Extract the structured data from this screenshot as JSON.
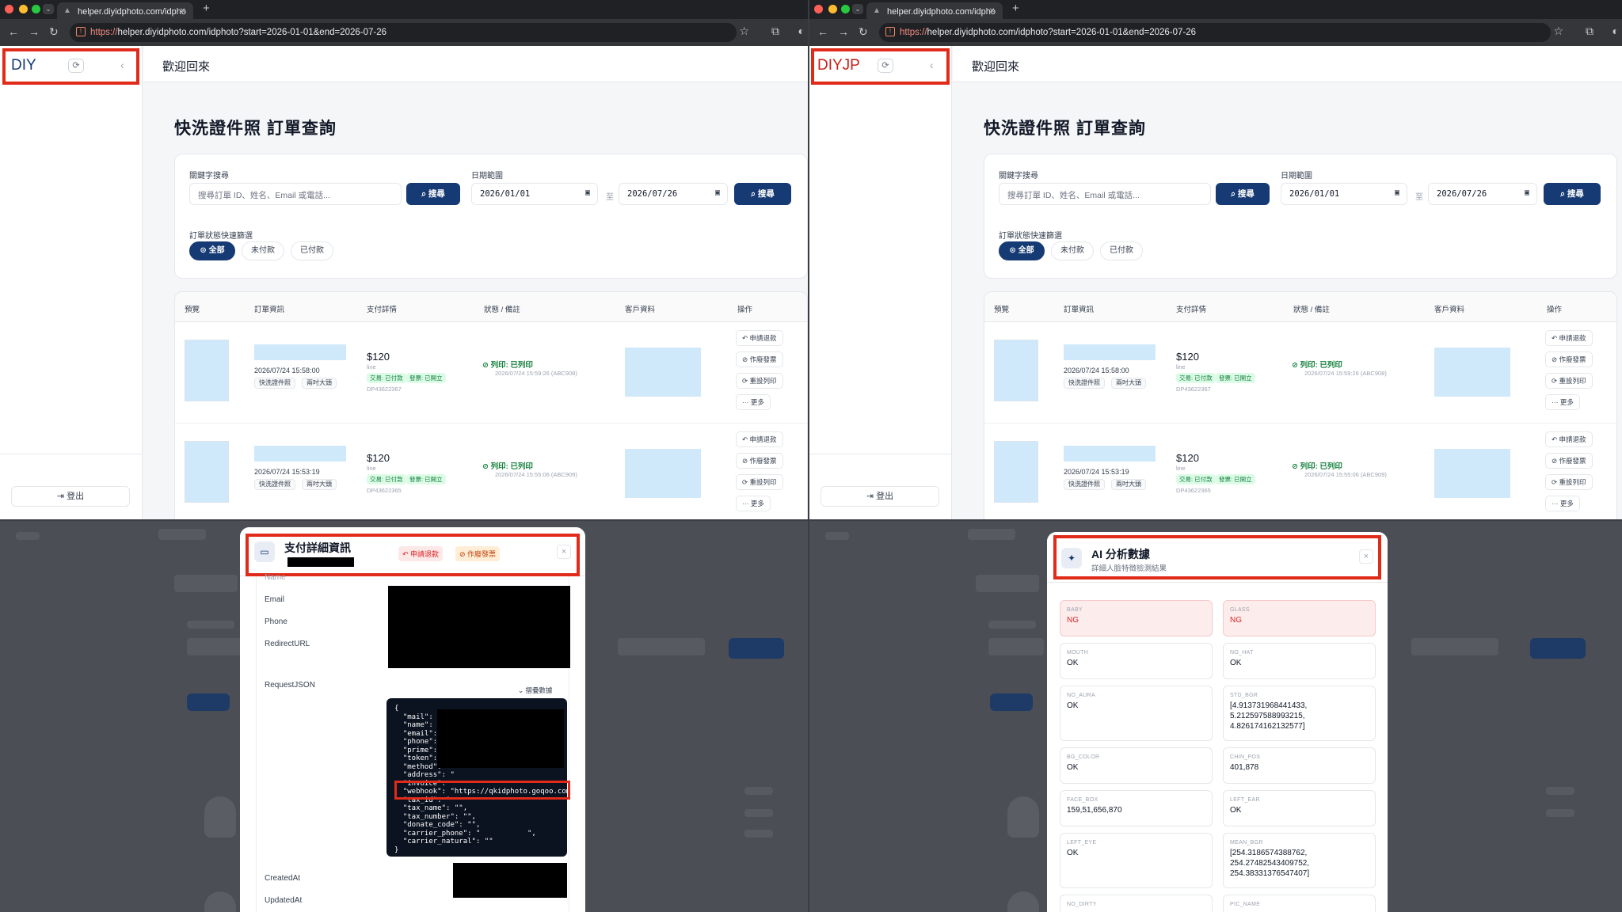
{
  "browser": {
    "tab_title": "helper.diyidphoto.com/idpho",
    "url_scheme": "https://",
    "url_rest": "helper.diyidphoto.com/idphoto?start=2026-01-01&end=2026-07-26"
  },
  "left_app": {
    "brand": "DIY",
    "logout": "登出",
    "welcome": "歡迎回來",
    "title": "快洗證件照 訂單查詢"
  },
  "right_app": {
    "brand": "DIYJP",
    "logout": "登出",
    "welcome": "歡迎回來",
    "title": "快洗證件照 訂單查詢"
  },
  "filters": {
    "keyword_label": "關鍵字搜尋",
    "keyword_placeholder": "搜尋訂單 ID、姓名、Email 或電話...",
    "search_label": "搜尋",
    "date_label": "日期範圍",
    "start_date": "2026/01/01",
    "end_date": "2026/07/26",
    "to_label": "至",
    "status_label": "訂單狀態快速篩選",
    "status_options": [
      "全部",
      "未付款",
      "已付款"
    ]
  },
  "table": {
    "headers": [
      "預覽",
      "訂單資訊",
      "支付詳情",
      "狀態 / 備註",
      "客戶資料",
      "操作"
    ],
    "rows": [
      {
        "date": "2026/07/24 15:58:00",
        "tag1": "快洗證件照",
        "tag2": "兩吋大頭",
        "price": "$120",
        "method": "line",
        "pay_status": "交易: 已付款",
        "invoice": "發票: 已開立",
        "order_no": "DP43622367",
        "status": "列印: 已列印",
        "status_note": "2026/07/24 15:59:26 (ABC908)"
      },
      {
        "date": "2026/07/24 15:53:19",
        "tag1": "快洗證件照",
        "tag2": "兩吋大頭",
        "price": "$120",
        "method": "line",
        "pay_status": "交易: 已付款",
        "invoice": "發票: 已開立",
        "order_no": "DP43622365",
        "status": "列印: 已列印",
        "status_note": "2026/07/24 15:55:06 (ABC909)"
      }
    ],
    "actions": [
      "申請退款",
      "作廢發票",
      "重設列印",
      "更多"
    ]
  },
  "payment_modal": {
    "title": "支付詳細資訊",
    "refund_label": "申請退款",
    "void_label": "作廢發票",
    "fields": [
      "Name",
      "Email",
      "Phone",
      "RedirectURL",
      "RequestJSON",
      "CreatedAt",
      "UpdatedAt"
    ],
    "collapse_label": "摺疊數據",
    "json_lines": [
      "{",
      "  \"mail\": \"\",",
      "  \"name\": \"\",",
      "  \"email\": \"",
      "  \"phone\": \"",
      "  \"prime\": \"",
      "  \"token\": \"",
      "  \"method\": \"",
      "  \"address\": \"",
      "  \"invoice\": ",
      "  \"webhook\": \"https://qkidphoto.goqoo.com",
      "  \"tax_id\": \"",
      "  \"tax_name\": \"\",",
      "  \"tax_number\": \"\",",
      "  \"donate_code\": \"\",",
      "  \"carrier_phone\": \"           \",",
      "  \"carrier_natural\": \"\"",
      "}"
    ]
  },
  "ai_modal": {
    "title": "AI 分析數據",
    "subtitle": "詳細人臉特徵檢測結果",
    "items": [
      {
        "key": "BABY",
        "value": "NG",
        "ng": true
      },
      {
        "key": "GLASS",
        "value": "NG",
        "ng": true
      },
      {
        "key": "MOUTH",
        "value": "OK",
        "ng": false
      },
      {
        "key": "NO_HAT",
        "value": "OK",
        "ng": false
      },
      {
        "key": "NO_AURA",
        "value": "OK",
        "ng": false
      },
      {
        "key": "STD_BGR",
        "value": "[4.913731968441433, 5.2125975889932​15, 4.826174162132577]",
        "ng": false
      },
      {
        "key": "BG_COLOR",
        "value": "OK",
        "ng": false
      },
      {
        "key": "CHIN_POS",
        "value": "401,878",
        "ng": false
      },
      {
        "key": "FACE_BOX",
        "value": "159,51,656,870",
        "ng": false
      },
      {
        "key": "LEFT_EAR",
        "value": "OK",
        "ng": false
      },
      {
        "key": "LEFT_EYE",
        "value": "OK",
        "ng": false
      },
      {
        "key": "MEAN_BGR",
        "value": "[254.3186574388762, 254.27482543409752, 254.38331376547407]",
        "ng": false
      },
      {
        "key": "NO_DIRTY",
        "value": "",
        "ng": false
      },
      {
        "key": "PIC_NAME",
        "value": "",
        "ng": false
      }
    ]
  }
}
